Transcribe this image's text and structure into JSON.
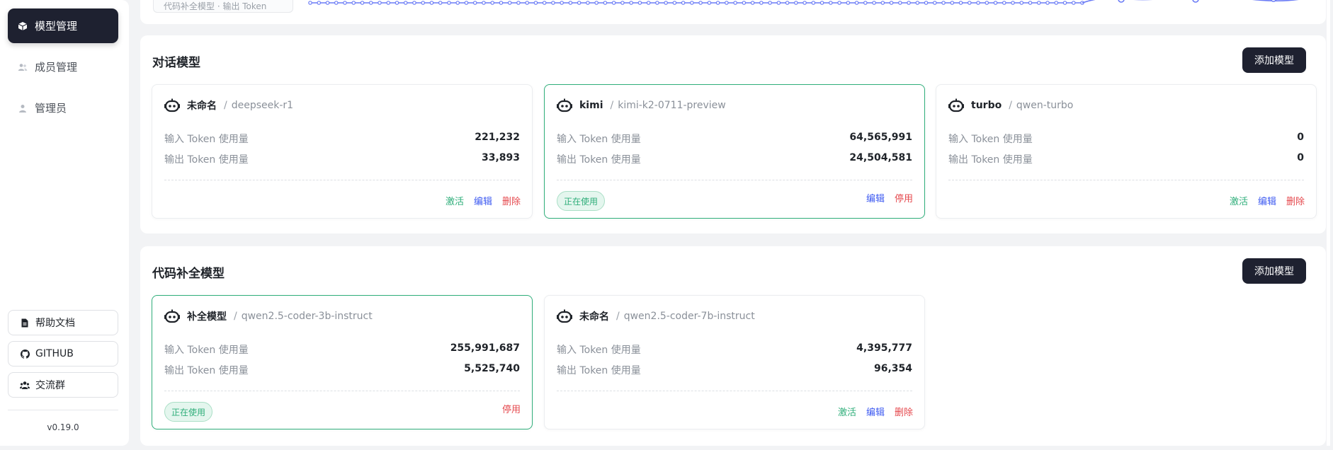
{
  "sidebar": {
    "nav": [
      {
        "label": "模型管理",
        "icon": "cube-icon",
        "active": true
      },
      {
        "label": "成员管理",
        "icon": "users-icon",
        "active": false
      },
      {
        "label": "管理员",
        "icon": "user-icon",
        "active": false
      }
    ],
    "links": [
      {
        "label": "帮助文档",
        "icon": "document-icon"
      },
      {
        "label": "GITHUB",
        "icon": "github-icon"
      },
      {
        "label": "交流群",
        "icon": "group-icon"
      }
    ],
    "version": "v0.19.0"
  },
  "chart_strip": {
    "legend_text": "代码补全模型 · 输出 Token",
    "series_color": "#6b7cf6"
  },
  "labels": {
    "input_tokens": "输入 Token 使用量",
    "output_tokens": "输出 Token 使用量",
    "activate": "激活",
    "edit": "编辑",
    "delete": "删除",
    "disable": "停用",
    "in_use": "正在使用",
    "add_model": "添加模型",
    "name_sep": "/"
  },
  "chat_section": {
    "title": "对话模型",
    "models": [
      {
        "name": "未命名",
        "model": "deepseek-r1",
        "input": "221,232",
        "output": "33,893",
        "in_use": false
      },
      {
        "name": "kimi",
        "model": "kimi-k2-0711-preview",
        "input": "64,565,991",
        "output": "24,504,581",
        "in_use": true
      },
      {
        "name": "turbo",
        "model": "qwen-turbo",
        "input": "0",
        "output": "0",
        "in_use": false
      }
    ]
  },
  "completion_section": {
    "title": "代码补全模型",
    "models": [
      {
        "name": "补全模型",
        "model": "qwen2.5-coder-3b-instruct",
        "input": "255,991,687",
        "output": "5,525,740",
        "in_use": true
      },
      {
        "name": "未命名",
        "model": "qwen2.5-coder-7b-instruct",
        "input": "4,395,777",
        "output": "96,354",
        "in_use": false
      }
    ]
  },
  "colors": {
    "accent_dark": "#1e2130",
    "active_green": "#2fae7a",
    "edit_blue": "#3d5af1",
    "danger_red": "#e5484d"
  }
}
